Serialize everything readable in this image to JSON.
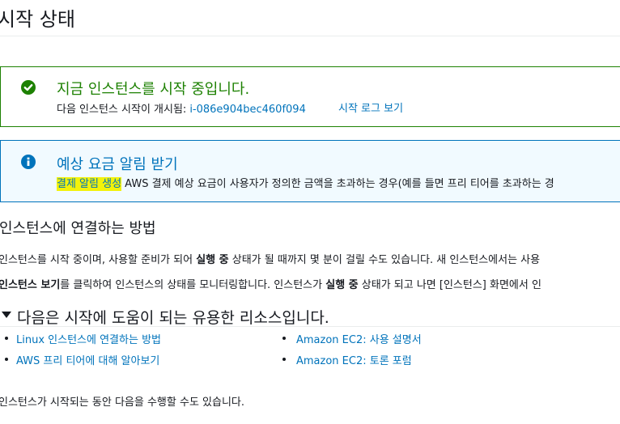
{
  "page": {
    "title": "시작 상태"
  },
  "success_alert": {
    "heading": "지금 인스턴스를 시작 중입니다.",
    "detail_prefix": "다음 인스턴스 시작이 개시됨:",
    "instance_id": "i-086e904bec460f094",
    "launch_log_link": "시작 로그 보기",
    "color": "#1d8102"
  },
  "info_alert": {
    "heading": "예상 요금 알림 받기",
    "link_text": "결제 알림 생성",
    "detail_text": " AWS 결제 예상 요금이 사용자가 정의한 금액을 초과하는 경우(예를 들면 프리 티어를 초과하는 경",
    "color": "#0073bb",
    "highlight_color": "#f2f20a"
  },
  "connect_section": {
    "title": "인스턴스에 연결하는 방법",
    "para1_a": "인스턴스를 시작 중이며, 사용할 준비가 되어 ",
    "para1_bold": "실행 중",
    "para1_b": " 상태가 될 때까지 몇 분이 걸릴 수도 있습니다. 새 인스턴스에서는 사용",
    "para2_bold1": "인스턴스 보기",
    "para2_a": "를 클릭하여 인스턴스의 상태를 모니터링합니다. 인스턴스가 ",
    "para2_bold2": "실행 중",
    "para2_b": " 상태가 되고 나면 [인스턴스] 화면에서 인"
  },
  "resources": {
    "title": "다음은 시작에 도움이 되는 유용한 리소스입니다.",
    "links_left": [
      "Linux 인스턴스에 연결하는 방법",
      "AWS 프리 티어에 대해 알아보기"
    ],
    "links_right": [
      "Amazon EC2: 사용 설명서",
      "Amazon EC2: 토론 포럼"
    ]
  },
  "launch_tasks": {
    "intro": "인스턴스가 시작되는 동안 다음을 수행할 수도 있습니다."
  }
}
